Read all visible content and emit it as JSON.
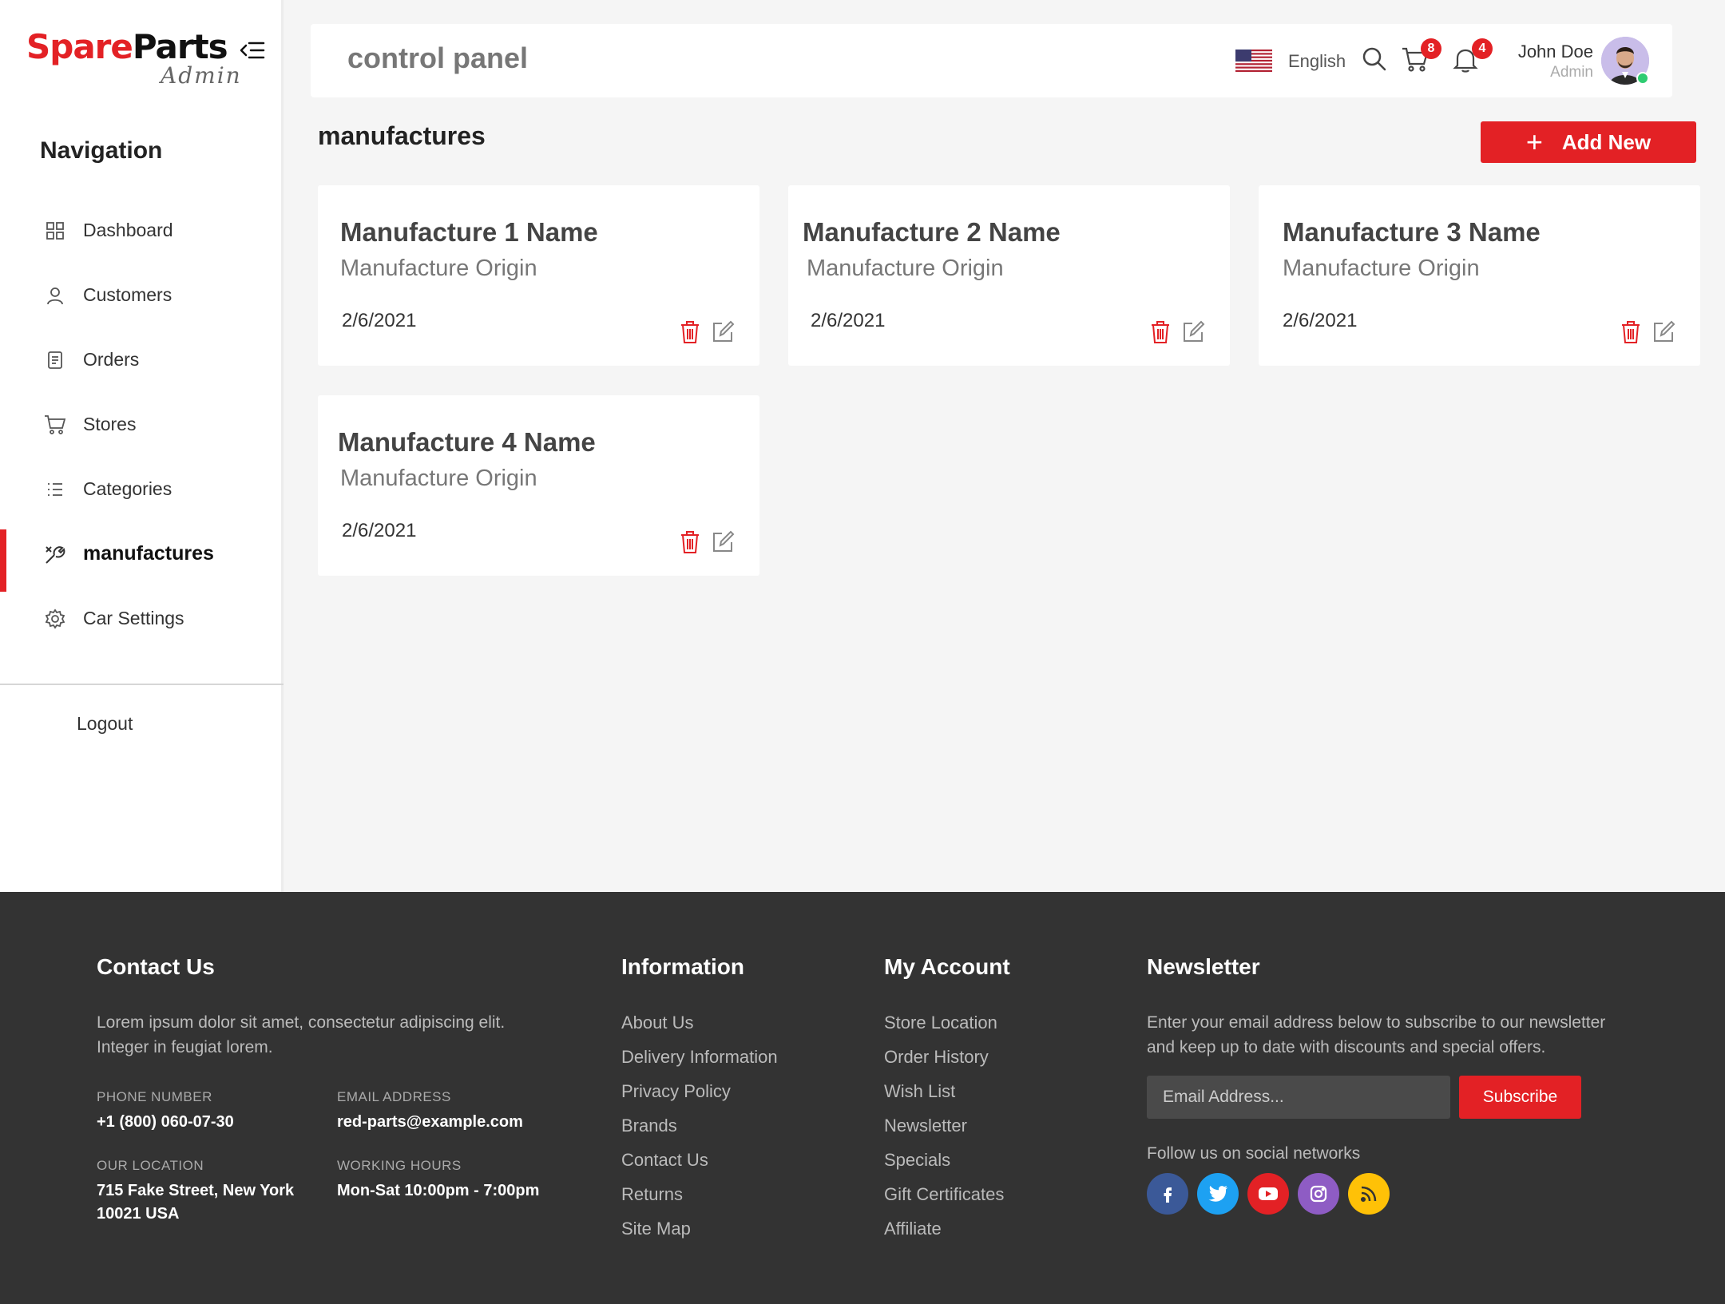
{
  "brand": {
    "name_part1": "Spare",
    "name_part2": "Parts",
    "sub": "Admin"
  },
  "sidebar": {
    "heading": "Navigation",
    "items": [
      {
        "label": "Dashboard",
        "icon": "dashboard-grid-icon"
      },
      {
        "label": "Customers",
        "icon": "user-icon"
      },
      {
        "label": "Orders",
        "icon": "document-icon"
      },
      {
        "label": "Stores",
        "icon": "cart-icon"
      },
      {
        "label": "Categories",
        "icon": "list-icon"
      },
      {
        "label": "manufactures",
        "icon": "tools-icon",
        "active": true
      },
      {
        "label": "Car Settings",
        "icon": "gear-icon"
      }
    ],
    "logout": "Logout"
  },
  "topbar": {
    "title": "control panel",
    "language": "English",
    "cart_count": "8",
    "notification_count": "4",
    "user_name": "John Doe",
    "user_role": "Admin"
  },
  "page": {
    "title": "manufactures",
    "add_button": "Add New"
  },
  "cards": [
    {
      "name": "Manufacture 1 Name",
      "origin": "Manufacture Origin",
      "date": "2/6/2021"
    },
    {
      "name": "Manufacture 2 Name",
      "origin": "Manufacture Origin",
      "date": "2/6/2021"
    },
    {
      "name": "Manufacture 3 Name",
      "origin": "Manufacture Origin",
      "date": "2/6/2021"
    },
    {
      "name": "Manufacture 4 Name",
      "origin": "Manufacture Origin",
      "date": "2/6/2021"
    }
  ],
  "footer": {
    "contact": {
      "heading": "Contact Us",
      "text_line1": "Lorem ipsum dolor sit amet, consectetur adipiscing elit.",
      "text_line2": "Integer in feugiat lorem.",
      "phone_label": "PHONE NUMBER",
      "phone": "+1 (800) 060-07-30",
      "email_label": "EMAIL ADDRESS",
      "email": "red-parts@example.com",
      "location_label": "OUR LOCATION",
      "location_line1": "715 Fake Street, New York",
      "location_line2": "10021 USA",
      "hours_label": "WORKING HOURS",
      "hours": "Mon-Sat 10:00pm - 7:00pm"
    },
    "information": {
      "heading": "Information",
      "links": [
        "About Us",
        "Delivery Information",
        "Privacy Policy",
        "Brands",
        "Contact Us",
        "Returns",
        "Site Map"
      ]
    },
    "account": {
      "heading": "My Account",
      "links": [
        "Store Location",
        "Order History",
        "Wish List",
        "Newsletter",
        "Specials",
        "Gift Certificates",
        "Affiliate"
      ]
    },
    "newsletter": {
      "heading": "Newsletter",
      "text_line1": "Enter your email address below to subscribe to our newsletter",
      "text_line2": "and keep up to date with discounts and special offers.",
      "placeholder": "Email Address...",
      "button": "Subscribe",
      "follow": "Follow us on social networks",
      "social": [
        {
          "icon": "facebook-icon",
          "color": "#3b5998"
        },
        {
          "icon": "twitter-icon",
          "color": "#1da1f2"
        },
        {
          "icon": "youtube-icon",
          "color": "#e32125"
        },
        {
          "icon": "instagram-icon",
          "color": "#8e5cc4"
        },
        {
          "icon": "rss-icon",
          "color": "#ffc107"
        }
      ]
    }
  },
  "colors": {
    "accent": "#e32125",
    "footer_bg": "#333333",
    "page_bg": "#f5f5f5"
  }
}
